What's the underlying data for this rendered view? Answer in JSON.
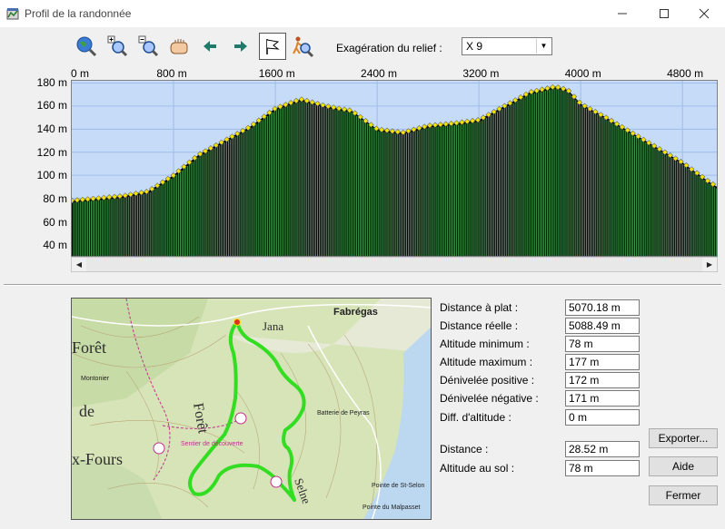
{
  "window": {
    "title": "Profil de la randonnée"
  },
  "toolbar": {
    "relief_label": "Exagération du relief :",
    "relief_value": "X 9",
    "buttons": [
      "globe-zoom-icon",
      "zoom-in-icon",
      "zoom-out-icon",
      "pan-hand-icon",
      "arrow-left-icon",
      "arrow-right-icon",
      "flag-icon",
      "walker-icon"
    ]
  },
  "chart_data": {
    "type": "bar",
    "xlabel": "",
    "ylabel": "",
    "x_ticks": [
      "0 m",
      "800 m",
      "1600 m",
      "2400 m",
      "3200 m",
      "4000 m",
      "4800 m"
    ],
    "y_ticks": [
      "180 m",
      "160 m",
      "140 m",
      "120 m",
      "100 m",
      "80 m",
      "60 m",
      "40 m"
    ],
    "xlim": [
      0,
      5070
    ],
    "ylim": [
      30,
      182
    ],
    "grid": true,
    "distance_m": [
      0,
      200,
      400,
      600,
      800,
      1000,
      1200,
      1400,
      1600,
      1800,
      2000,
      2200,
      2400,
      2600,
      2800,
      3000,
      3200,
      3400,
      3600,
      3800,
      3900,
      4000,
      4200,
      4400,
      4600,
      4800,
      5000,
      5070
    ],
    "altitude_m": [
      78,
      80,
      82,
      86,
      100,
      118,
      130,
      142,
      158,
      166,
      160,
      156,
      140,
      137,
      143,
      145,
      148,
      160,
      172,
      177,
      174,
      162,
      150,
      137,
      124,
      111,
      95,
      90
    ],
    "colors": {
      "sky": "#c6dbf7",
      "ground": "#000000",
      "bars": "#3e9a4c",
      "points": "#f3e300"
    }
  },
  "stats": [
    {
      "label": "Distance à plat :",
      "value": "5070.18 m"
    },
    {
      "label": "Distance réelle :",
      "value": "5088.49 m"
    },
    {
      "label": "Altitude minimum :",
      "value": "78 m"
    },
    {
      "label": "Altitude maximum :",
      "value": "177 m"
    },
    {
      "label": "Dénivelée positive :",
      "value": "172 m"
    },
    {
      "label": "Dénivelée négative :",
      "value": "171 m"
    },
    {
      "label": "Diff. d'altitude :",
      "value": "0 m"
    },
    {
      "label": "Distance :",
      "value": "28.52 m"
    },
    {
      "label": "Altitude au sol :",
      "value": "78 m"
    }
  ],
  "buttons": {
    "export": "Exporter...",
    "help": "Aide",
    "close": "Fermer"
  },
  "map": {
    "labels": [
      "Forêt",
      "de",
      "x-Fours",
      "Fabrégas",
      "Forêt",
      "Batterie de Peyras",
      "Pointe de St-Selon",
      "Pointe du Malpasset",
      "Montonier",
      "Sentier de découverte",
      "Jana",
      "Selne"
    ]
  }
}
